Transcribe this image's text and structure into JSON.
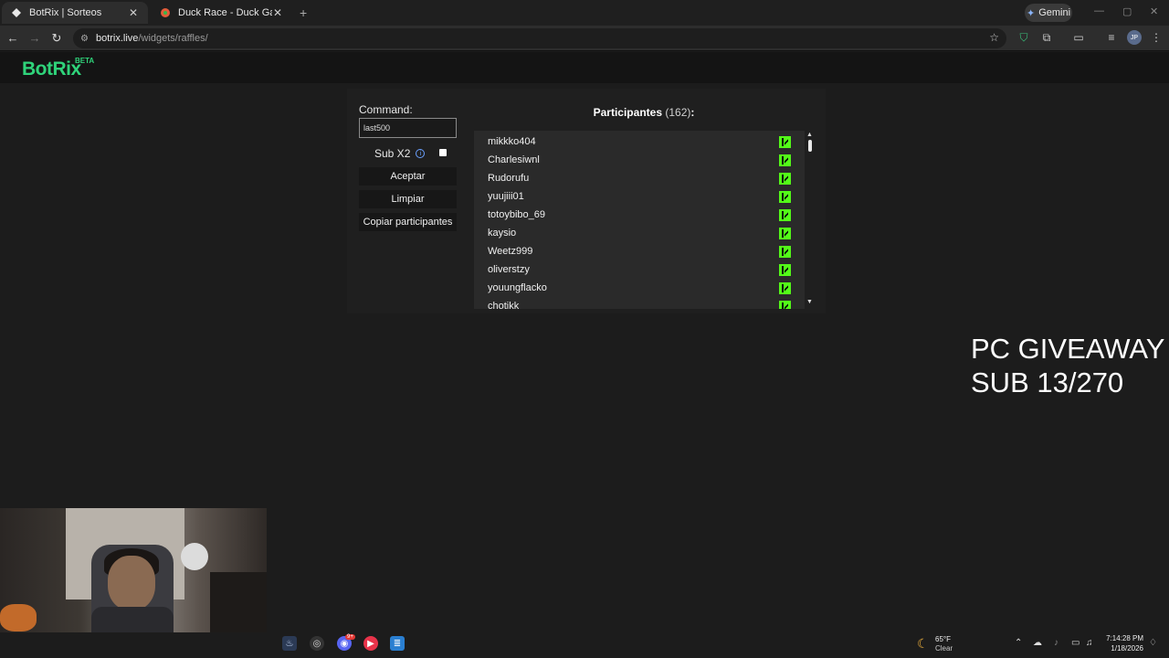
{
  "browser": {
    "tabs": [
      {
        "title": "BotRix | Sorteos",
        "active": true
      },
      {
        "title": "Duck Race - Duck Games",
        "active": false
      }
    ],
    "close_glyph": "✕",
    "new_tab_glyph": "+",
    "gemini_label": "Gemini",
    "url_host": "botrix.live",
    "url_path": "/widgets/raffles/",
    "profile_initials": "JP"
  },
  "site": {
    "logo": "BotRix",
    "badge": "BETA"
  },
  "raffle": {
    "command_label": "Command:",
    "command_value": "last500",
    "sub_label": "Sub X2",
    "sub_checked": false,
    "accept_label": "Aceptar",
    "clear_label": "Limpiar",
    "copy_label": "Copiar participantes",
    "participants_title": "Participantes",
    "participants_count": "(162)",
    "participants_suffix": ":",
    "participants": [
      "mikkko404",
      "Charlesiwnl",
      "Rudorufu",
      "yuujiii01",
      "totoybibo_69",
      "kaysio",
      "Weetz999",
      "oliverstzy",
      "youungflacko",
      "chotikk"
    ],
    "platform_icon": "kick-icon",
    "brand_color": "#53fc18"
  },
  "overlay": {
    "line1": "PC GIVEAWAY",
    "line2": "SUB 13/270"
  },
  "taskbar": {
    "weather_temp": "65°F",
    "weather_condition": "Clear",
    "time": "7:14:28 PM",
    "date": "1/18/2026",
    "discord_badge": "9+"
  }
}
